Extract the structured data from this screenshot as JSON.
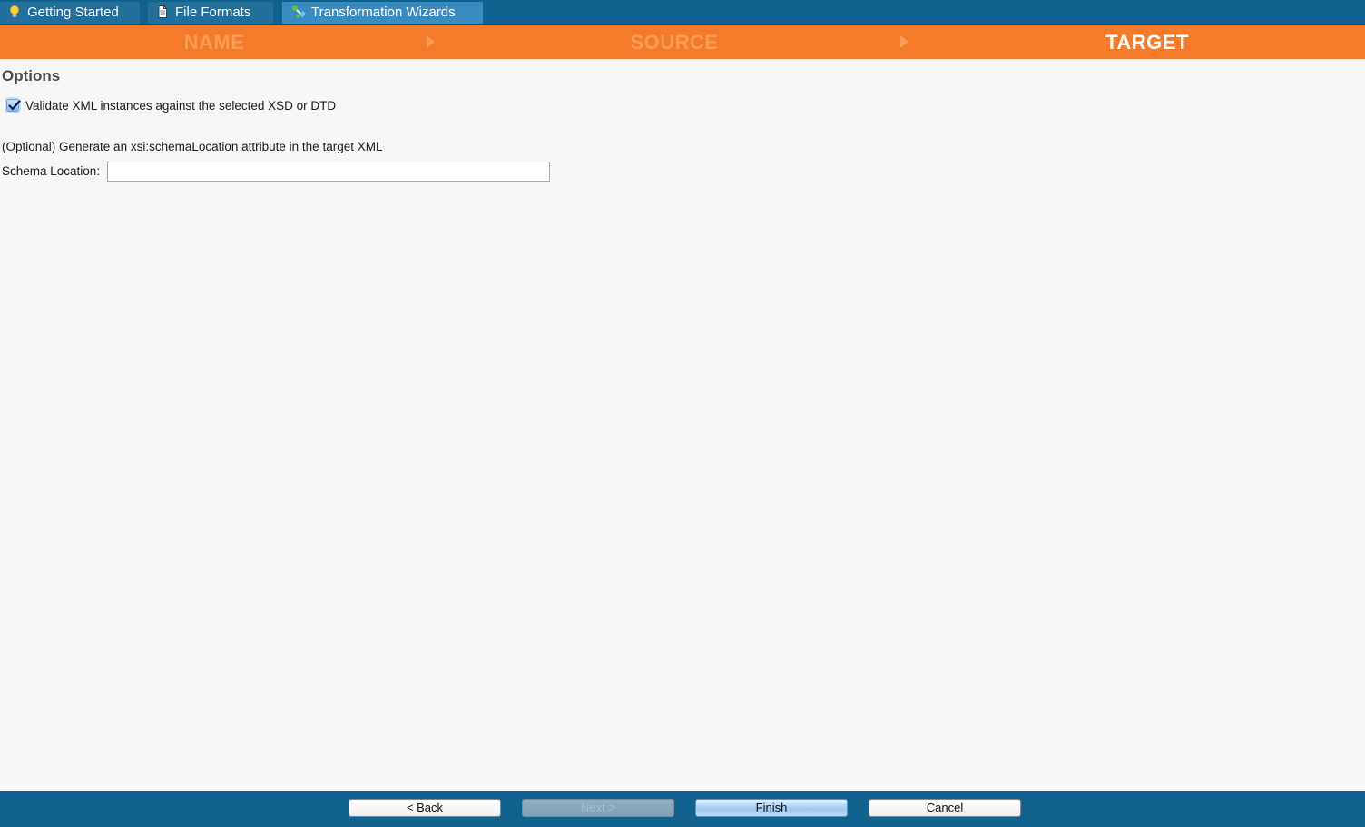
{
  "tabs": [
    {
      "label": "Getting Started",
      "icon": "lightbulb-icon",
      "active": false
    },
    {
      "label": "File Formats",
      "icon": "document-icon",
      "active": false
    },
    {
      "label": "Transformation Wizards",
      "icon": "wizard-icon",
      "active": true
    }
  ],
  "wizard_steps": [
    {
      "label": "NAME",
      "current": false
    },
    {
      "label": "SOURCE",
      "current": false
    },
    {
      "label": "TARGET",
      "current": true
    }
  ],
  "options": {
    "title": "Options",
    "validate_checkbox": {
      "label": "Validate XML instances against the selected XSD or DTD",
      "checked": true
    },
    "optional_text": "(Optional) Generate an xsi:schemaLocation attribute in the target XML",
    "schema_location": {
      "label": "Schema Location:",
      "value": ""
    }
  },
  "footer": {
    "back_label": "< Back",
    "next_label": "Next >",
    "finish_label": "Finish",
    "cancel_label": "Cancel"
  },
  "colors": {
    "header_blue": "#12628f",
    "step_orange": "#f47b2a",
    "step_inactive_text": "#fb9b56",
    "step_active_text": "#ffffff"
  }
}
